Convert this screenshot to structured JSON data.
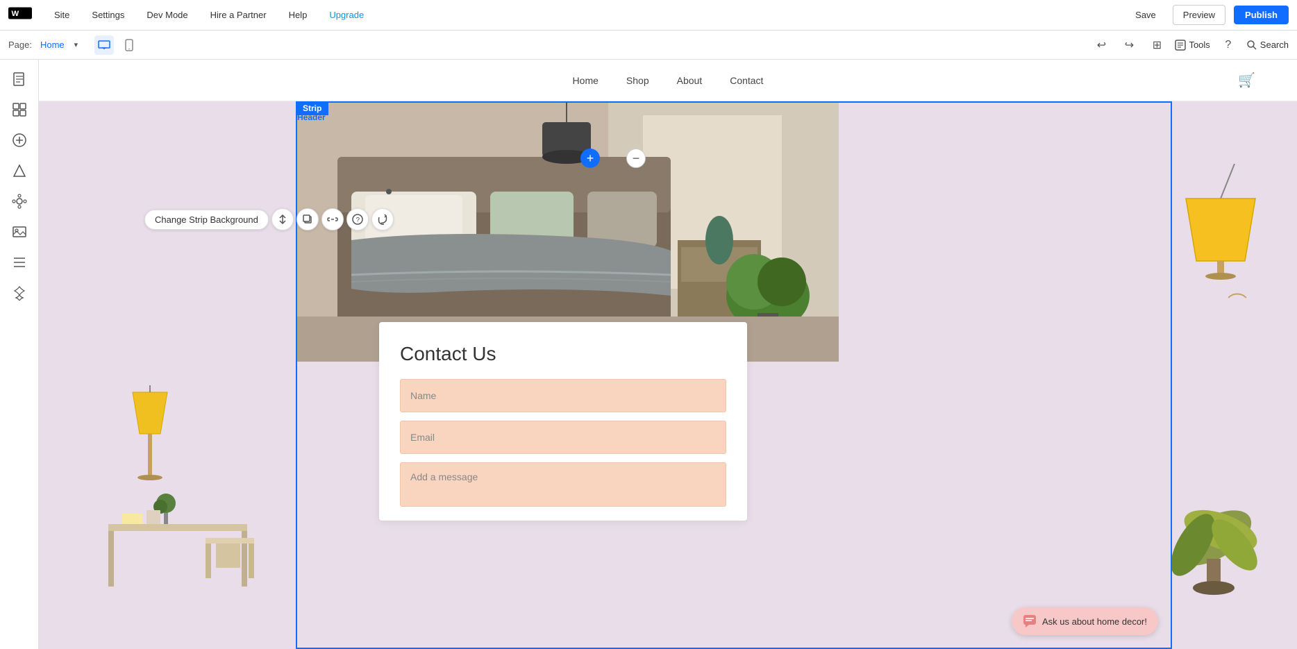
{
  "topbar": {
    "logo": "W",
    "nav": [
      "Site",
      "Settings",
      "Dev Mode",
      "Hire a Partner",
      "Help"
    ],
    "upgrade": "Upgrade",
    "save": "Save",
    "preview": "Preview",
    "publish": "Publish"
  },
  "secondbar": {
    "page_label": "Page:",
    "page_name": "Home",
    "tools": "Tools",
    "search": "Search"
  },
  "sidebar": {
    "icons": [
      "pages",
      "elements",
      "add",
      "design",
      "apps",
      "media",
      "menus",
      "ai"
    ]
  },
  "site_nav": {
    "items": [
      "Home",
      "Shop",
      "About",
      "Contact"
    ]
  },
  "strip": {
    "label": "Strip",
    "header_label": "Header"
  },
  "strip_toolbar": {
    "change_bg": "Change Strip Background"
  },
  "contact_form": {
    "title": "Contact Us",
    "name_placeholder": "Name",
    "email_placeholder": "Email",
    "message_placeholder": "Add a message"
  },
  "chat_widget": {
    "text": "Ask us about home decor!"
  }
}
